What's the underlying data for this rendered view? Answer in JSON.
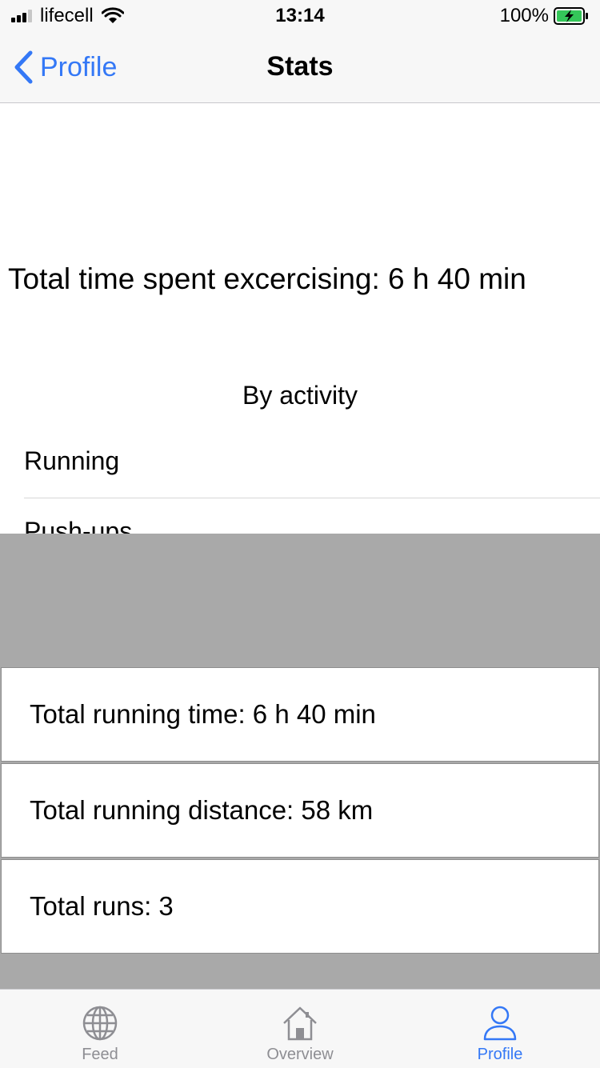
{
  "status_bar": {
    "carrier": "lifecell",
    "time": "13:14",
    "battery": "100%"
  },
  "nav": {
    "back_label": "Profile",
    "title": "Stats"
  },
  "content": {
    "total_time_text": "Total time spent excercising: 6 h 40 min",
    "section_title": "By activity",
    "activities": [
      {
        "label": "Running"
      },
      {
        "label": "Push-ups"
      }
    ]
  },
  "popup": {
    "stats": [
      {
        "label": "Total running time: 6 h 40 min"
      },
      {
        "label": "Total running distance: 58 km"
      },
      {
        "label": "Total runs: 3"
      }
    ]
  },
  "tab_bar": {
    "tabs": [
      {
        "label": "Feed",
        "icon": "globe-icon"
      },
      {
        "label": "Overview",
        "icon": "house-icon"
      },
      {
        "label": "Profile",
        "icon": "person-icon"
      }
    ],
    "active_color": "#3478f6",
    "inactive_color": "#8e8e93"
  }
}
